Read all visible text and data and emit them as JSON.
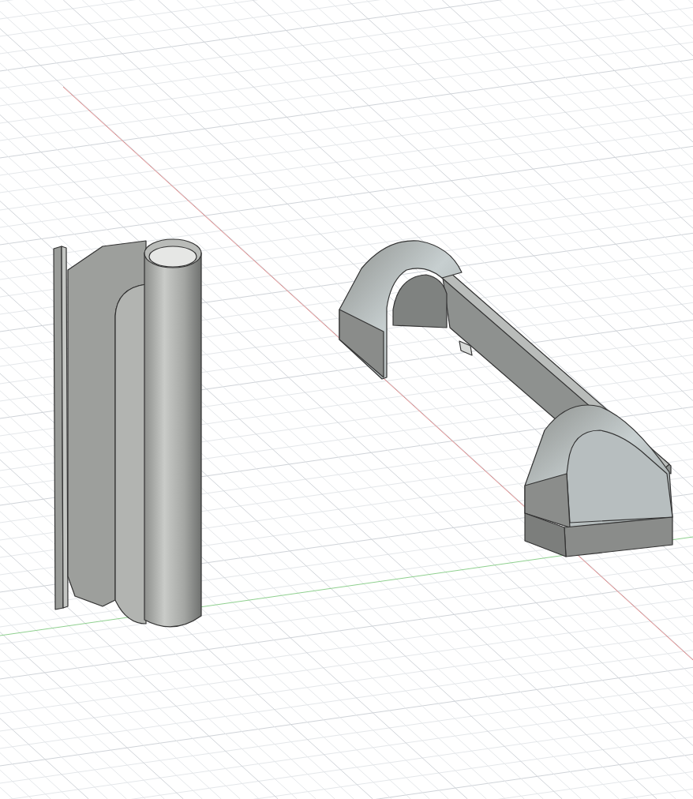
{
  "viewport": {
    "axes": [
      {
        "kind": "x",
        "color": "#e28a8a"
      },
      {
        "kind": "y",
        "color": "#8fd08f"
      }
    ],
    "models": [
      {
        "kind": "tube"
      },
      {
        "kind": "handle"
      }
    ]
  }
}
